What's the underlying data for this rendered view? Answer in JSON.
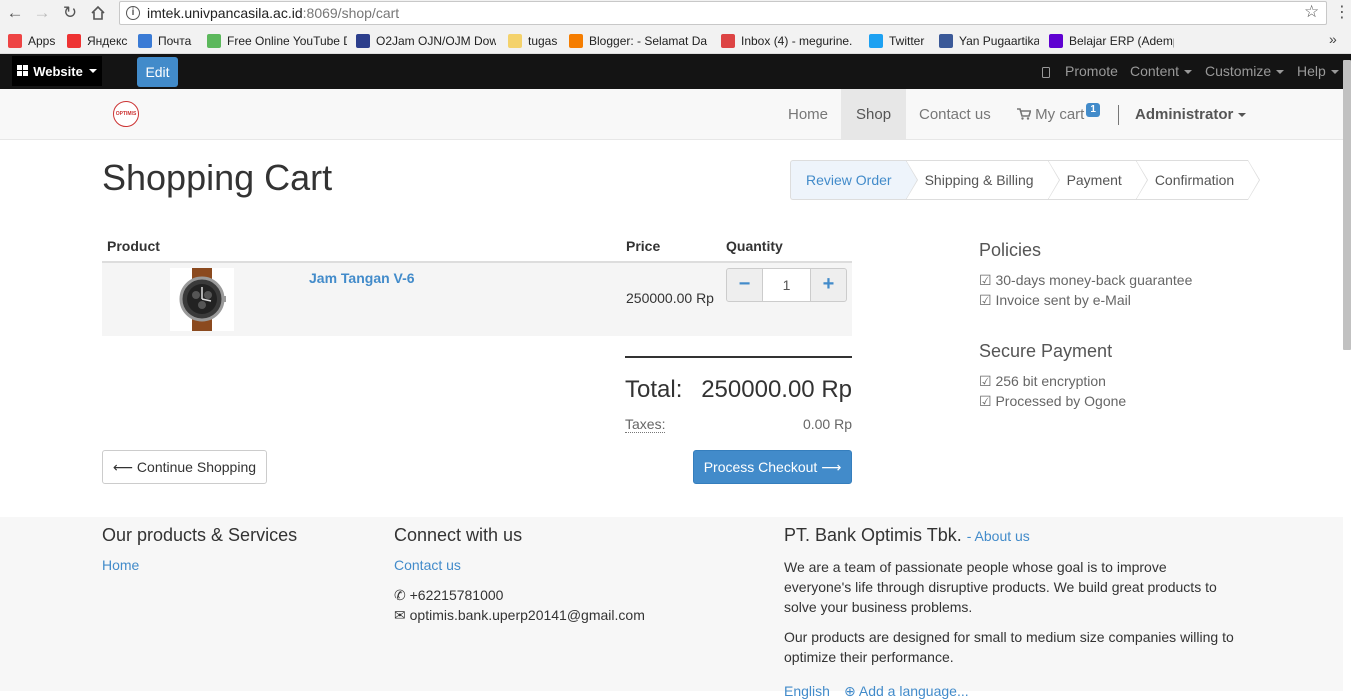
{
  "browser": {
    "url_host": "imtek.univpancasila.ac.id",
    "url_path": ":8069/shop/cart",
    "bookmarks": [
      {
        "label": "Apps",
        "icon": "apps-grid-icon",
        "color": "#e44"
      },
      {
        "label": "Яндекс",
        "icon": "yandex-icon",
        "color": "#e33"
      },
      {
        "label": "Почта",
        "icon": "mail-icon",
        "color": "#3a7bd5"
      },
      {
        "label": "Free Online YouTube D",
        "icon": "download-arrow-icon",
        "color": "#5cb85c"
      },
      {
        "label": "O2Jam OJN/OJM Dow",
        "icon": "o2jam-icon",
        "color": "#2c3e8c"
      },
      {
        "label": "tugas",
        "icon": "folder-icon",
        "color": "#f4d26b"
      },
      {
        "label": "Blogger: - Selamat Da",
        "icon": "blogger-icon",
        "color": "#f57d00"
      },
      {
        "label": "Inbox (4) - megurine.",
        "icon": "gmail-icon",
        "color": "#d44"
      },
      {
        "label": "Twitter",
        "icon": "twitter-icon",
        "color": "#1da1f2"
      },
      {
        "label": "Yan Pugaartika",
        "icon": "facebook-icon",
        "color": "#3b5998"
      },
      {
        "label": "Belajar ERP (Adempie",
        "icon": "yahoo-icon",
        "color": "#5f01d1"
      }
    ]
  },
  "odoo_bar": {
    "website": "Website",
    "edit": "Edit",
    "promote": "Promote",
    "content": "Content",
    "customize": "Customize",
    "help": "Help"
  },
  "site_nav": {
    "home": "Home",
    "shop": "Shop",
    "contact": "Contact us",
    "cart": "My cart",
    "cart_count": "1",
    "user": "Administrator"
  },
  "page": {
    "title": "Shopping Cart",
    "wizard": [
      "Review Order",
      "Shipping & Billing",
      "Payment",
      "Confirmation"
    ]
  },
  "cart": {
    "headers": {
      "product": "Product",
      "price": "Price",
      "quantity": "Quantity"
    },
    "items": [
      {
        "name": "Jam Tangan V-6",
        "price": "250000.00 Rp",
        "quantity": "1"
      }
    ],
    "total_label": "Total:",
    "total_value": "250000.00 Rp",
    "taxes_label": "Taxes:",
    "taxes_value": "0.00 Rp",
    "continue": "Continue Shopping",
    "checkout": "Process Checkout"
  },
  "sidebar": {
    "policies_title": "Policies",
    "policies": [
      "30-days money-back guarantee",
      "Invoice sent by e-Mail"
    ],
    "secure_title": "Secure Payment",
    "secure": [
      "256 bit encryption",
      "Processed by Ogone"
    ]
  },
  "footer": {
    "products_title": "Our products & Services",
    "products_link": "Home",
    "connect_title": "Connect with us",
    "contact_link": "Contact us",
    "phone": "+62215781000",
    "email": "optimis.bank.uperp20141@gmail.com",
    "company": "PT. Bank Optimis Tbk.",
    "about": "- About us",
    "para1": "We are a team of passionate people whose goal is to improve everyone's life through disruptive products. We build great products to solve your business problems.",
    "para2": "Our products are designed for small to medium size companies willing to optimize their performance.",
    "language": "English",
    "add_language": "Add a language..."
  }
}
